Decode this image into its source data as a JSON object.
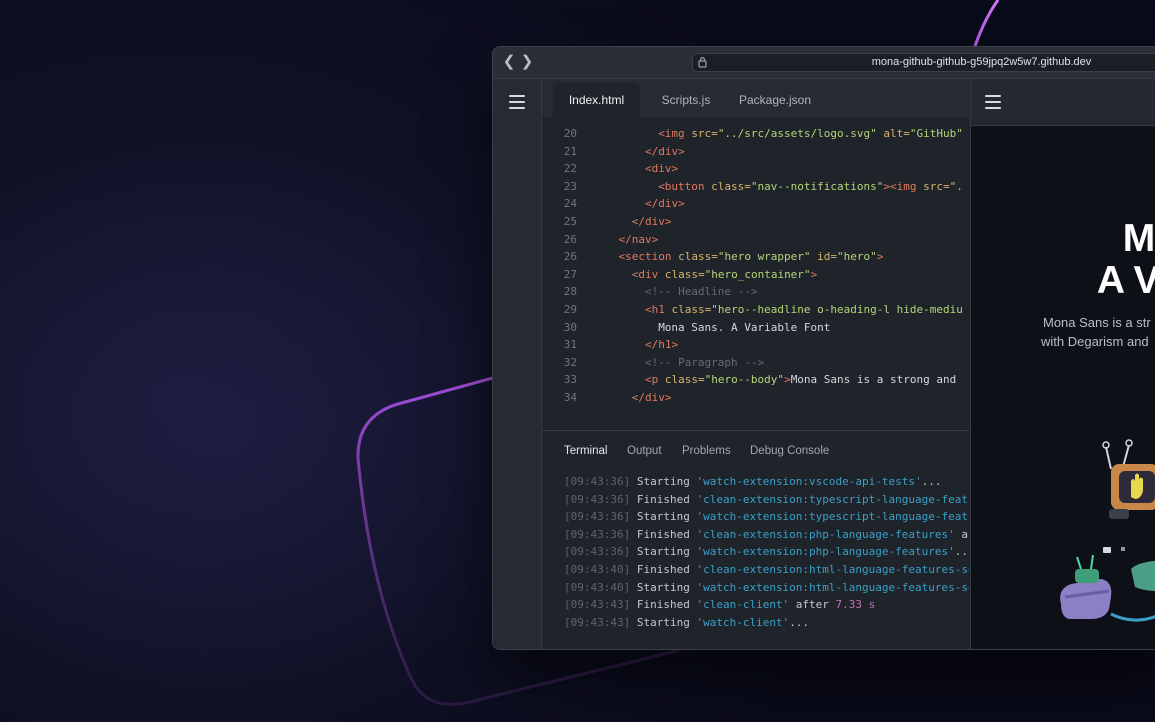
{
  "browser": {
    "url": "mona-github-github-g59jpq2w5w7.github.dev"
  },
  "editor": {
    "tabs": [
      {
        "label": "Index.html",
        "active": true
      },
      {
        "label": "Scripts.js",
        "active": false
      },
      {
        "label": "Package.json",
        "active": false
      }
    ],
    "code_lines": [
      {
        "n": "20",
        "indent": 5,
        "parts": [
          [
            "tg",
            "<img "
          ],
          [
            "at",
            "src="
          ],
          [
            "st",
            "\"../src/assets/logo.svg\""
          ],
          [
            "at",
            " alt="
          ],
          [
            "st",
            "\"GitHub\""
          ]
        ]
      },
      {
        "n": "21",
        "indent": 4,
        "parts": [
          [
            "tg",
            "</div>"
          ]
        ]
      },
      {
        "n": "22",
        "indent": 4,
        "parts": [
          [
            "tg",
            "<div>"
          ]
        ]
      },
      {
        "n": "23",
        "indent": 5,
        "parts": [
          [
            "tg",
            "<button "
          ],
          [
            "at",
            "class="
          ],
          [
            "st",
            "\"nav--notifications\""
          ],
          [
            "tg",
            "><img "
          ],
          [
            "at",
            "src="
          ],
          [
            "st",
            "\"."
          ]
        ]
      },
      {
        "n": "24",
        "indent": 4,
        "parts": [
          [
            "tg",
            "</div>"
          ]
        ]
      },
      {
        "n": "25",
        "indent": 3,
        "parts": [
          [
            "tg",
            "</div>"
          ]
        ]
      },
      {
        "n": "26",
        "indent": 2,
        "parts": [
          [
            "tg",
            "</nav>"
          ]
        ]
      },
      {
        "n": "26",
        "indent": 2,
        "parts": [
          [
            "tg",
            "<section "
          ],
          [
            "at",
            "class="
          ],
          [
            "st",
            "\"hero wrapper\""
          ],
          [
            "at",
            " id="
          ],
          [
            "st",
            "\"hero\""
          ],
          [
            "tg",
            ">"
          ]
        ]
      },
      {
        "n": "27",
        "indent": 3,
        "parts": [
          [
            "tg",
            "<div "
          ],
          [
            "at",
            "class="
          ],
          [
            "st",
            "\"hero_container\""
          ],
          [
            "tg",
            ">"
          ]
        ]
      },
      {
        "n": "28",
        "indent": 4,
        "parts": [
          [
            "cm",
            "<!-- Headline -->"
          ]
        ]
      },
      {
        "n": "29",
        "indent": 4,
        "parts": [
          [
            "tg",
            "<h1 "
          ],
          [
            "at",
            "class="
          ],
          [
            "st",
            "\"hero--headline o-heading-l hide-mediu"
          ]
        ]
      },
      {
        "n": "30",
        "indent": 5,
        "parts": [
          [
            "tx",
            "Mona Sans. A Variable Font"
          ]
        ]
      },
      {
        "n": "31",
        "indent": 4,
        "parts": [
          [
            "tg",
            "</h1>"
          ]
        ]
      },
      {
        "n": "32",
        "indent": 4,
        "parts": [
          [
            "cm",
            "<!-- Paragraph -->"
          ]
        ]
      },
      {
        "n": "33",
        "indent": 4,
        "parts": [
          [
            "tg",
            "<p "
          ],
          [
            "at",
            "class="
          ],
          [
            "st",
            "\"hero--body\""
          ],
          [
            "tg",
            ">"
          ],
          [
            "tx",
            "Mona Sans is a strong and"
          ]
        ]
      },
      {
        "n": "34",
        "indent": 3,
        "parts": [
          [
            "tg",
            "</div>"
          ]
        ]
      }
    ]
  },
  "panel": {
    "tabs": [
      {
        "label": "Terminal",
        "active": true
      },
      {
        "label": "Output",
        "active": false
      },
      {
        "label": "Problems",
        "active": false
      },
      {
        "label": "Debug Console",
        "active": false
      }
    ],
    "terminal_lines": [
      {
        "time": "[09:43:36]",
        "verb": "Starting",
        "task": "'watch-extension:vscode-api-tests'",
        "rest": "..."
      },
      {
        "time": "[09:43:36]",
        "verb": "Finished",
        "task": "'clean-extension:typescript-language-featu",
        "rest": ""
      },
      {
        "time": "[09:43:36]",
        "verb": "Starting",
        "task": "'watch-extension:typescript-language-featu",
        "rest": ""
      },
      {
        "time": "[09:43:36]",
        "verb": "Finished",
        "task": "'clean-extension:php-language-features'",
        "rest": " af"
      },
      {
        "time": "[09:43:36]",
        "verb": "Starting",
        "task": "'watch-extension:php-language-features'",
        "rest": "..."
      },
      {
        "time": "[09:43:40]",
        "verb": "Finished",
        "task": "'clean-extension:html-language-features-se",
        "rest": ""
      },
      {
        "time": "[09:43:40]",
        "verb": "Starting",
        "task": "'watch-extension:html-language-features-se",
        "rest": ""
      },
      {
        "time": "[09:43:43]",
        "verb": "Finished",
        "task": "'clean-client'",
        "rest": " after ",
        "num": "7.33 s"
      },
      {
        "time": "[09:43:43]",
        "verb": "Starting",
        "task": "'watch-client'",
        "rest": "..."
      }
    ]
  },
  "preview": {
    "headline_line1": "Mo",
    "headline_line2": "A Va",
    "body_line1": "Mona Sans is a str",
    "body_line2": "with Degarism and"
  },
  "colors": {
    "accent_purple": "#9b4fd6",
    "terminal_task": "#3aa0c8"
  }
}
